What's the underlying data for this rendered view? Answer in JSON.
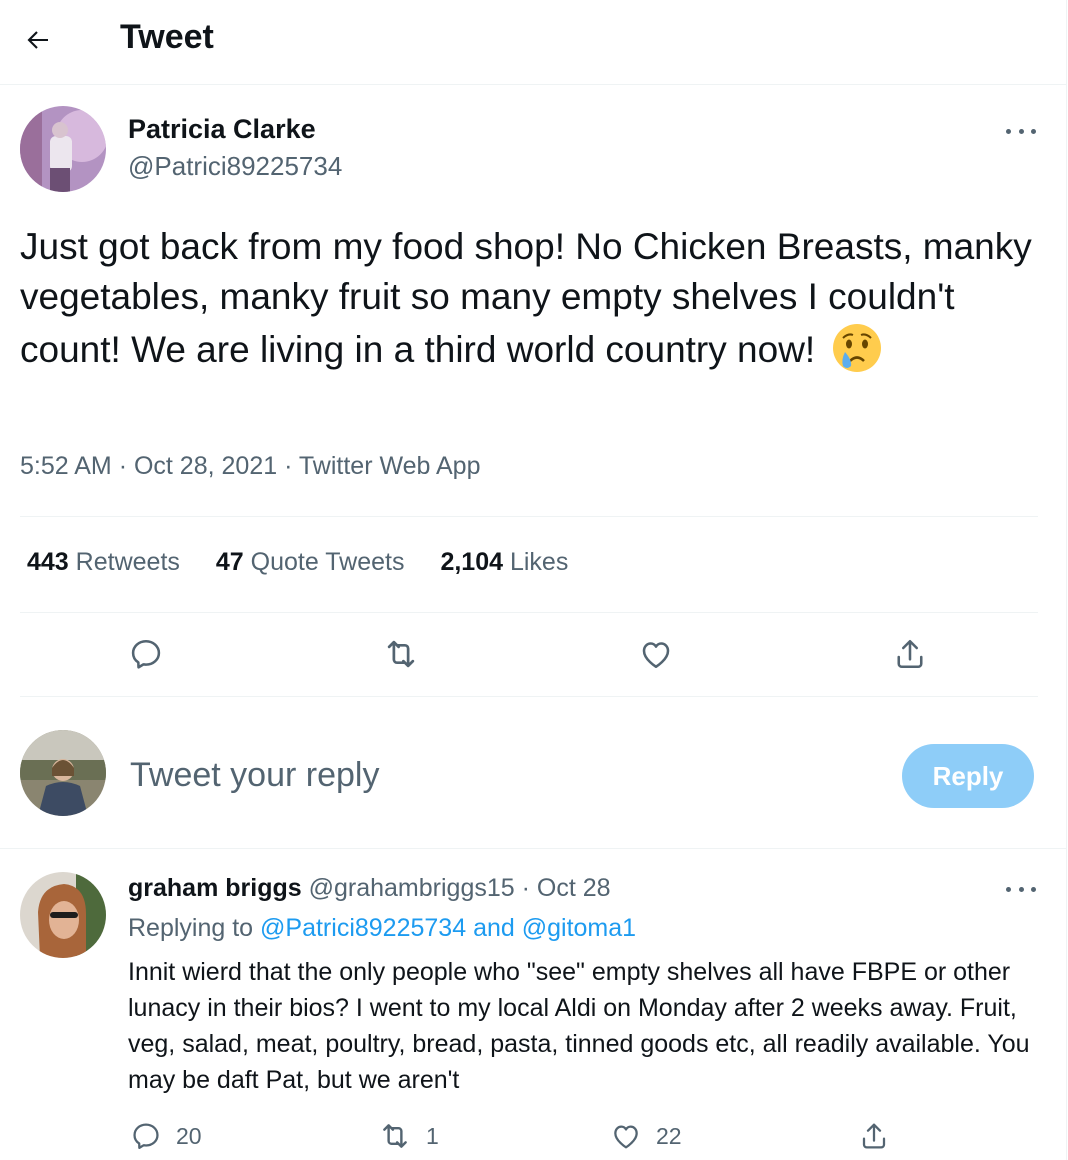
{
  "header": {
    "title": "Tweet"
  },
  "tweet": {
    "author_name": "Patricia Clarke",
    "author_handle": "@Patrici89225734",
    "text": "Just got back from my food shop! No Chicken Breasts, manky vegetables, manky fruit so many empty shelves I couldn't count! We are living in a third world country now!",
    "emoji": "crying-face",
    "time": "5:52 AM",
    "date": "Oct 28, 2021",
    "source": "Twitter Web App",
    "stats": {
      "retweets_count": "443",
      "retweets_label": "Retweets",
      "quotes_count": "47",
      "quotes_label": "Quote Tweets",
      "likes_count": "2,104",
      "likes_label": "Likes"
    },
    "actions": [
      "reply-icon",
      "retweet-icon",
      "like-icon",
      "share-icon"
    ]
  },
  "compose": {
    "placeholder": "Tweet your reply",
    "reply_button": "Reply"
  },
  "reply": {
    "author_name": "graham briggs",
    "author_handle": "@grahambriggs15",
    "separator": "·",
    "date": "Oct 28",
    "replying_prefix": "Replying to",
    "replying_user1": "@Patrici89225734",
    "replying_and": "and",
    "replying_user2": "@gitoma1",
    "text": "Innit wierd that the only people who \"see\" empty shelves all have FBPE or other lunacy in their bios? I went to my local Aldi on Monday after 2 weeks away. Fruit, veg, salad, meat, poultry, bread, pasta, tinned goods etc, all readily available. You may be daft Pat, but we aren't",
    "reply_count": "20",
    "retweet_count": "1",
    "like_count": "22"
  },
  "colors": {
    "accent": "#1d9bf0",
    "reply_button_disabled": "#8ecdf8",
    "muted_text": "#536471"
  }
}
